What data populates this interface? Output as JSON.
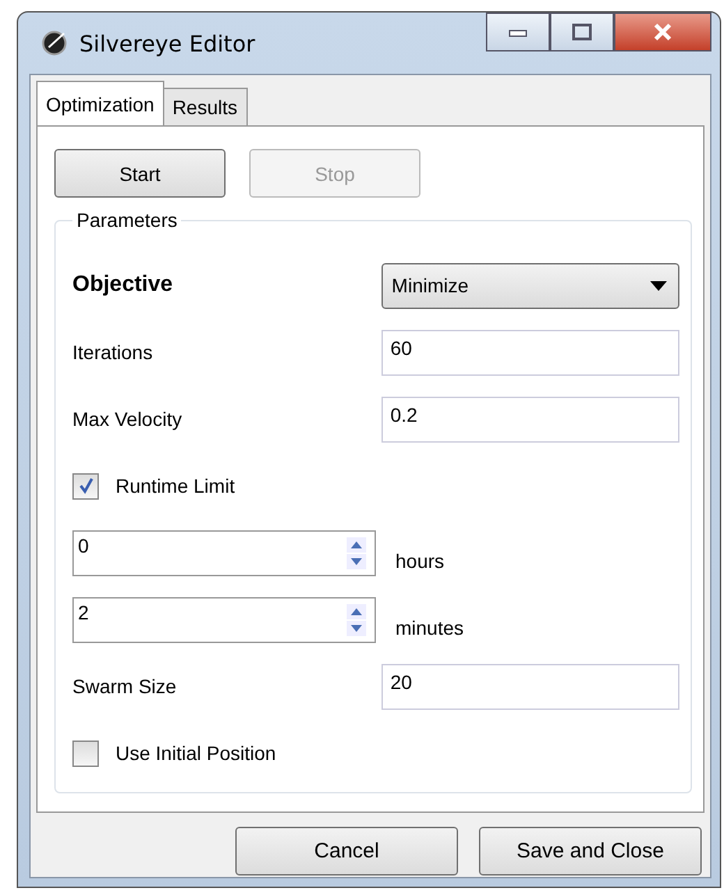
{
  "window": {
    "title": "Silvereye Editor"
  },
  "tabs": [
    {
      "label": "Optimization",
      "selected": true
    },
    {
      "label": "Results",
      "selected": false
    }
  ],
  "run_buttons": [
    {
      "label": "Start",
      "disabled": false
    },
    {
      "label": "Stop",
      "disabled": true
    }
  ],
  "parameters": {
    "title": "Parameters",
    "rows": [
      {
        "kind": "dropdown",
        "label": "Objective",
        "value": "Minimize"
      },
      {
        "kind": "field",
        "label": "Iterations",
        "value": "60"
      },
      {
        "kind": "field",
        "label": "Max Velocity",
        "value": "0.2"
      },
      {
        "kind": "checkbox",
        "label": "Runtime Limit",
        "checked": true
      },
      {
        "kind": "spinner",
        "value": "0",
        "unit": "hours"
      },
      {
        "kind": "spinner",
        "value": "2",
        "unit": "minutes"
      },
      {
        "kind": "field",
        "label": "Swarm Size",
        "value": "20"
      },
      {
        "kind": "checkbox",
        "label": "Use Initial Position",
        "checked": false
      }
    ]
  },
  "footer_buttons": [
    "Cancel",
    "Save and Close"
  ]
}
